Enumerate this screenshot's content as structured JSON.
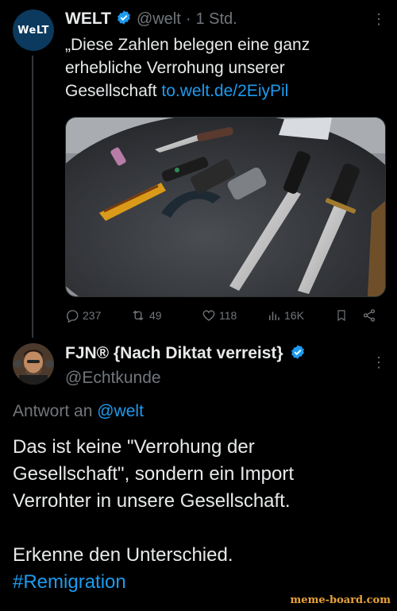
{
  "tweet1": {
    "avatar_text": "WeLT",
    "name": "WELT",
    "handle": "@welt",
    "separator": "·",
    "time": "1 Std.",
    "text_line1": "„Diese Zahlen belegen eine ganz",
    "text_line2": "erhebliche Verrohung unserer",
    "text_line3": "Gesellschaft",
    "link": "to.welt.de/2EiyPil",
    "stats": {
      "replies": "237",
      "retweets": "49",
      "likes": "118",
      "views": "16K"
    }
  },
  "tweet2": {
    "name": "FJN® {Nach Diktat verreist}",
    "handle": "@Echtkunde",
    "reply_prefix": "Antwort an",
    "reply_to": "@welt",
    "text_line1": "Das ist keine \"Verrohung der",
    "text_line2": "Gesellschaft\", sondern ein Import",
    "text_line3": "Verrohter in unsere Gesellschaft.",
    "text_line4": "Erkenne den Unterschied.",
    "hashtag": "#Remigration"
  },
  "watermark": "meme-board.com",
  "colors": {
    "accent": "#1d9bf0",
    "muted": "#71767b",
    "text": "#e7e9ea",
    "background": "#000000"
  }
}
